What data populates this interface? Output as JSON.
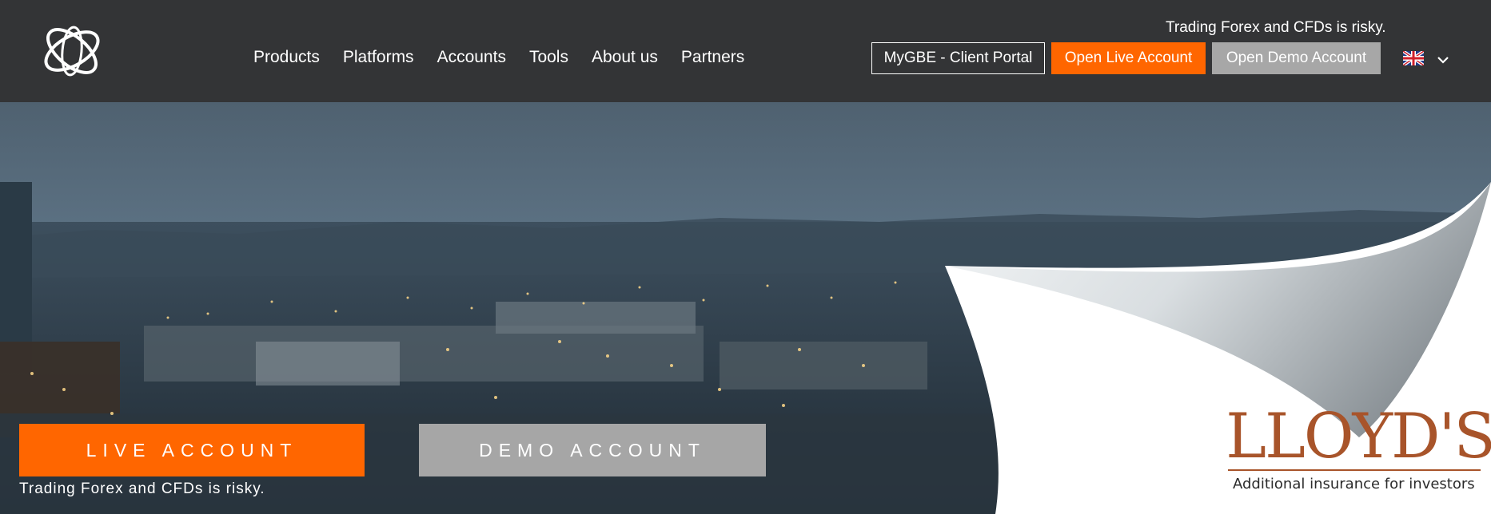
{
  "header": {
    "risk_warning": "Trading Forex and CFDs is risky.",
    "nav": [
      "Products",
      "Platforms",
      "Accounts",
      "Tools",
      "About us",
      "Partners"
    ],
    "portal_label": "MyGBE - Client Portal",
    "live_label": "Open Live Account",
    "demo_label": "Open Demo Account",
    "language_icon": "uk-flag-icon"
  },
  "hero": {
    "live_label": "LIVE ACCOUNT",
    "demo_label": "DEMO ACCOUNT",
    "risk_warning": "Trading Forex and CFDs is risky.",
    "lloyds_logo": "LLOYD'S",
    "lloyds_tagline": "Additional insurance for investors"
  },
  "colors": {
    "header_bg": "#333436",
    "accent_orange": "#ff6600",
    "demo_gray": "#a7a7a7",
    "lloyds_brown": "#a8542a"
  }
}
